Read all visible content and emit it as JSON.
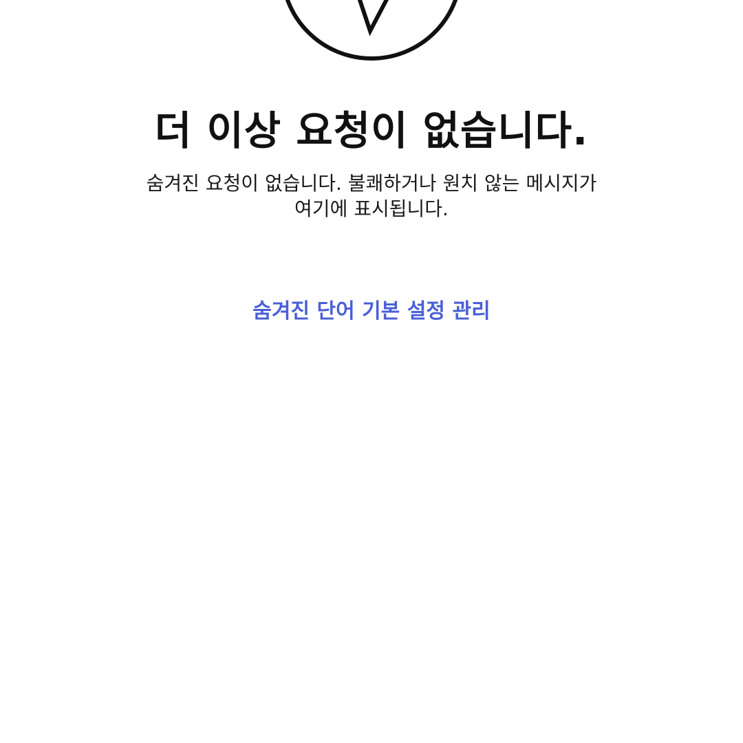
{
  "empty_state": {
    "icon": "paper-plane-circle-icon",
    "title": "더 이상 요청이 없습니다.",
    "description": "숨겨진 요청이 없습니다. 불쾌하거나 원치 않는 메시지가 여기에 표시됩니다.",
    "manage_link_label": "숨겨진 단어 기본 설정 관리"
  },
  "colors": {
    "background": "#ffffff",
    "title": "#111111",
    "body_text": "#1a1a1a",
    "link": "#4a5fd6",
    "icon_stroke": "#111111"
  }
}
